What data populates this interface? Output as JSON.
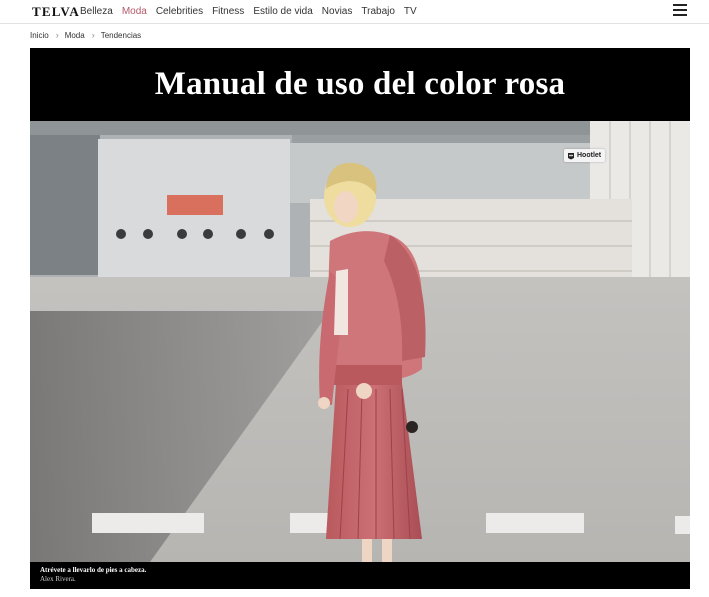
{
  "brand": {
    "logo_text": "TELVA"
  },
  "nav": {
    "items": [
      {
        "label": "Belleza",
        "active": false
      },
      {
        "label": "Moda",
        "active": true
      },
      {
        "label": "Celebrities",
        "active": false
      },
      {
        "label": "Fitness",
        "active": false
      },
      {
        "label": "Estilo de vida",
        "active": false
      },
      {
        "label": "Novias",
        "active": false
      },
      {
        "label": "Trabajo",
        "active": false
      },
      {
        "label": "TV",
        "active": false
      }
    ],
    "menu_icon": "hamburger-icon",
    "active_color": "#b35a6a"
  },
  "breadcrumb": [
    {
      "label": "Inicio"
    },
    {
      "label": "Moda"
    },
    {
      "label": "Tendencias"
    }
  ],
  "article": {
    "title": "Manual de uso del color rosa",
    "hootlet_label": "Hootlet",
    "caption": "Atrévete a llevarlo de pies a cabeza.",
    "credit": "Alex Rivera."
  }
}
